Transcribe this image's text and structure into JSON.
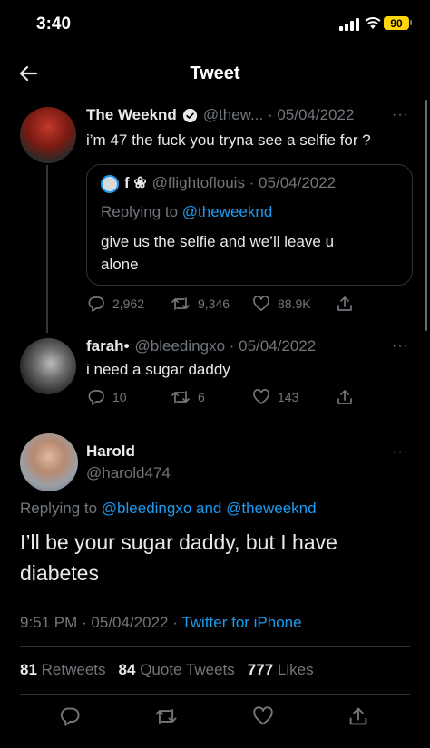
{
  "status_bar": {
    "time": "3:40",
    "battery": "90"
  },
  "header": {
    "title": "Tweet"
  },
  "tweet1": {
    "name": "The Weeknd",
    "meta": "@thew... · 05/04/2022",
    "text": "i’m 47 the fuck you tryna see a selfie for ?",
    "quote": {
      "name": "f ❀",
      "meta": "@flightoflouis · 05/04/2022",
      "replying_prefix": "Replying to",
      "replying_to": "@theweeknd",
      "text": "give us the selfie and we’ll leave u alone"
    },
    "replies": "2,962",
    "retweets": "9,346",
    "likes": "88.9K"
  },
  "tweet2": {
    "name": "farah•",
    "meta": "@bleedingxo · 05/04/2022",
    "text": "i need a sugar daddy",
    "replies": "10",
    "retweets": "6",
    "likes": "143"
  },
  "main_tweet": {
    "name": "Harold",
    "handle": "@harold474",
    "replying_prefix": "Replying to",
    "replying_to": "@bleedingxo and @theweeknd",
    "text": "I’ll be your sugar daddy, but I have diabetes",
    "time_date": "9:51 PM · 05/04/2022 ·",
    "source": "Twitter for iPhone",
    "retweets_count": "81",
    "retweets_label": "Retweets",
    "quotes_count": "84",
    "quotes_label": "Quote Tweets",
    "likes_count": "777",
    "likes_label": "Likes"
  },
  "colors": {
    "accent": "#1d9bf0",
    "background": "#000000",
    "muted": "#71767b",
    "battery": "#ffd60a"
  },
  "icons": [
    "back-arrow-icon",
    "verified-badge-icon",
    "more-icon",
    "reply-icon",
    "retweet-icon",
    "like-icon",
    "share-icon",
    "signal-icon",
    "wifi-icon",
    "battery-icon"
  ]
}
